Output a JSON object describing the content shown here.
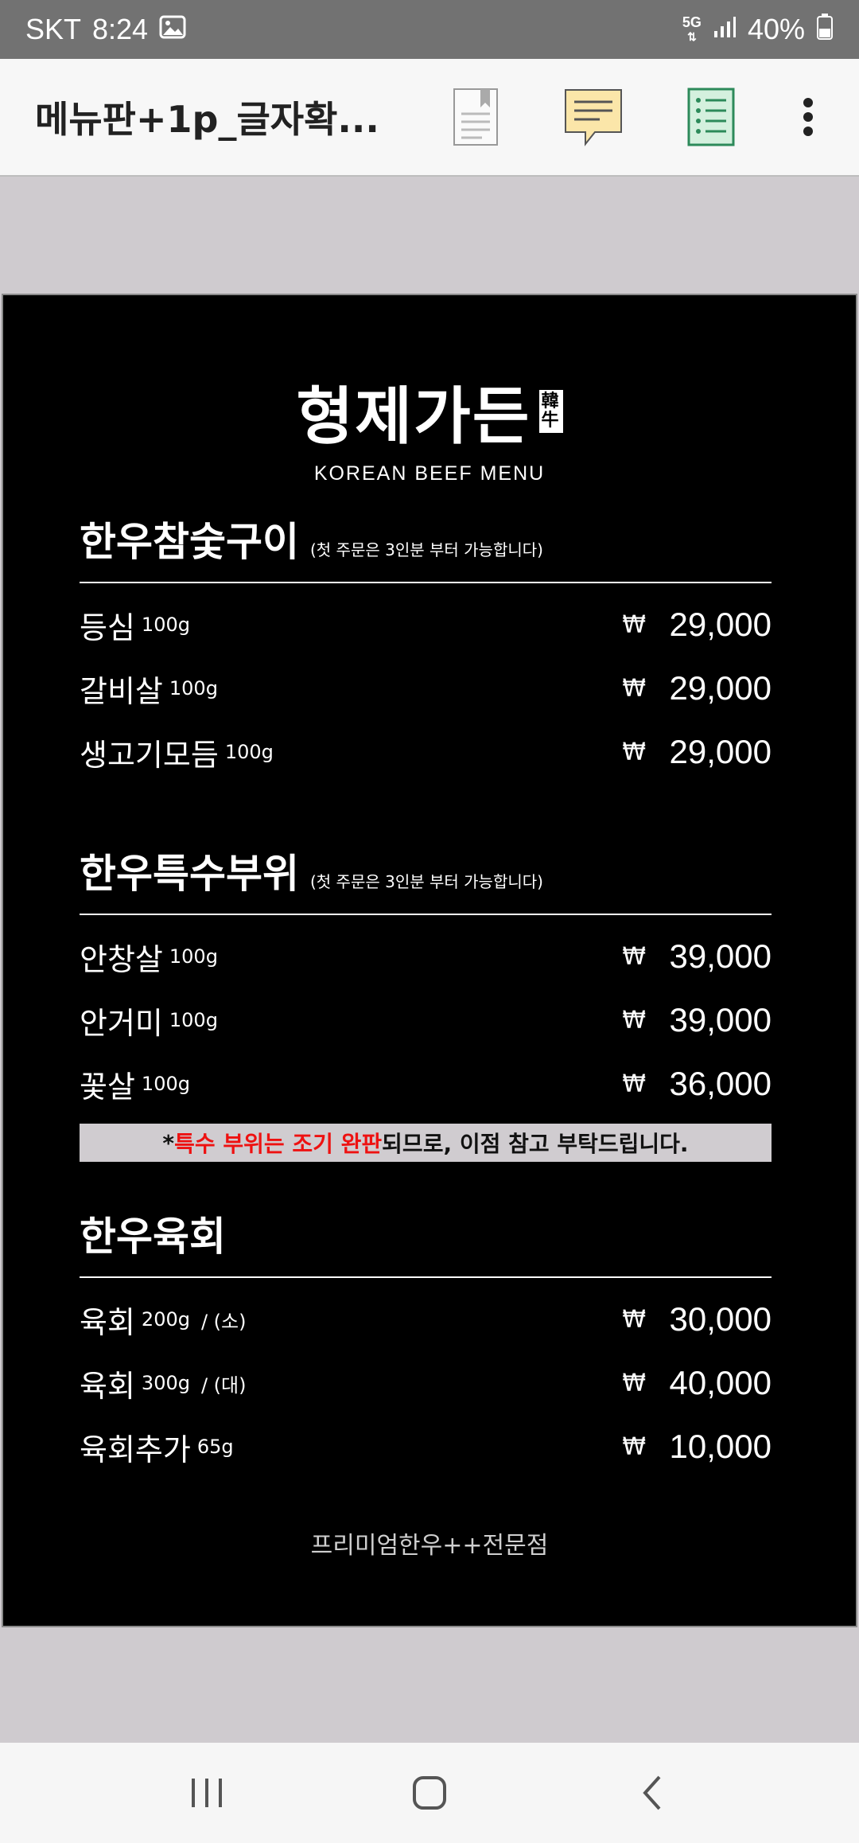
{
  "status_bar": {
    "carrier": "SKT",
    "time": "8:24",
    "network": "5G",
    "battery": "40%"
  },
  "app_bar": {
    "title": "메뉴판+1p_글자확...",
    "icons": [
      "bookmark-icon",
      "comment-icon",
      "outline-list-icon",
      "more-vert-icon"
    ]
  },
  "menu": {
    "brand_name": "형제가든",
    "brand_stamp": [
      "韓",
      "牛"
    ],
    "brand_sub": "KOREAN BEEF MENU",
    "currency": "₩",
    "sections": [
      {
        "title": "한우참숯구이",
        "note": "(첫 주문은 3인분 부터 가능합니다)",
        "items": [
          {
            "name": "등심",
            "weight": "100g",
            "size": "",
            "price": "29,000"
          },
          {
            "name": "갈비살",
            "weight": "100g",
            "size": "",
            "price": "29,000"
          },
          {
            "name": "생고기모듬",
            "weight": "100g",
            "size": "",
            "price": "29,000"
          }
        ]
      },
      {
        "title": "한우특수부위",
        "note": "(첫 주문은 3인분 부터 가능합니다)",
        "items": [
          {
            "name": "안창살",
            "weight": "100g",
            "size": "",
            "price": "39,000"
          },
          {
            "name": "안거미",
            "weight": "100g",
            "size": "",
            "price": "39,000"
          },
          {
            "name": "꽃살",
            "weight": "100g",
            "size": "",
            "price": "36,000"
          }
        ]
      },
      {
        "title": "한우육회",
        "note": "",
        "items": [
          {
            "name": "육회",
            "weight": "200g",
            "size": "/ (소)",
            "price": "30,000"
          },
          {
            "name": "육회",
            "weight": "300g",
            "size": "/ (대)",
            "price": "40,000"
          },
          {
            "name": "육회추가",
            "weight": "65g",
            "size": "",
            "price": "10,000"
          }
        ]
      }
    ],
    "notice": {
      "prefix": "* ",
      "highlight": "특수 부위는 조기 완판",
      "rest": " 되므로, 이점 참고 부탁드립니다."
    },
    "footer": "프리미엄한우++전문점"
  },
  "colors": {
    "status_bar": "#727272",
    "page_bg": "#000000",
    "viewer_bg": "#cfcbcf",
    "notice_bg": "#d0ccd0",
    "notice_red": "#ee1111"
  }
}
